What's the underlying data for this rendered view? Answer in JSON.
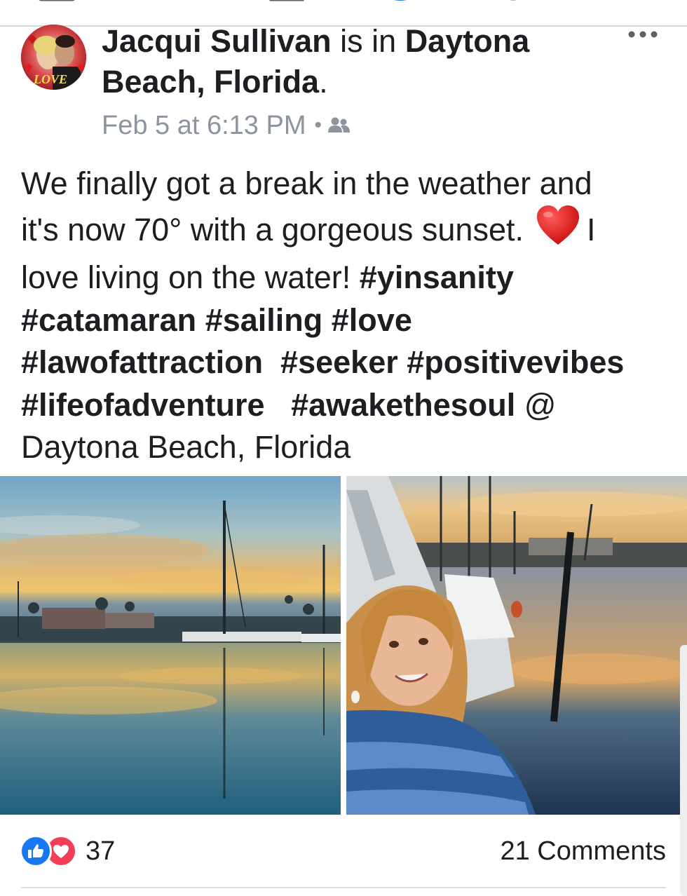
{
  "post": {
    "author": "Jacqui Sullivan",
    "is_in": "is in",
    "location_line1": "Daytona",
    "location_line2": "Beach, Florida",
    "period": ".",
    "timestamp": "Feb 5 at 6:13 PM",
    "separator": "•",
    "audience_icon": "friends-icon",
    "body": {
      "line1": "We finally got a break in the weather and",
      "line2a": "it's now 70° with a gorgeous sunset.",
      "line2b": "I",
      "line3a": "love living on the water! ",
      "tag_yinsanity": "#yinsanity",
      "tag_catamaran": "#catamaran",
      "tag_sailing": "#sailing",
      "tag_love": "#love",
      "tag_lawofattraction": "#lawofattraction",
      "tag_seeker": "#seeker",
      "tag_positivevibes": "#positivevibes",
      "tag_lifeofadventure": "#lifeofadventure",
      "tag_awakethesoul": "#awakethesoul",
      "at": "@",
      "place": "Daytona Beach, Florida"
    }
  },
  "footer": {
    "reaction_count": "37",
    "comments": "21 Comments"
  },
  "colors": {
    "like_blue": "#1877f2",
    "love_red": "#f33e58",
    "meta_gray": "#8d949e"
  },
  "avatar_badge": "LOVE"
}
